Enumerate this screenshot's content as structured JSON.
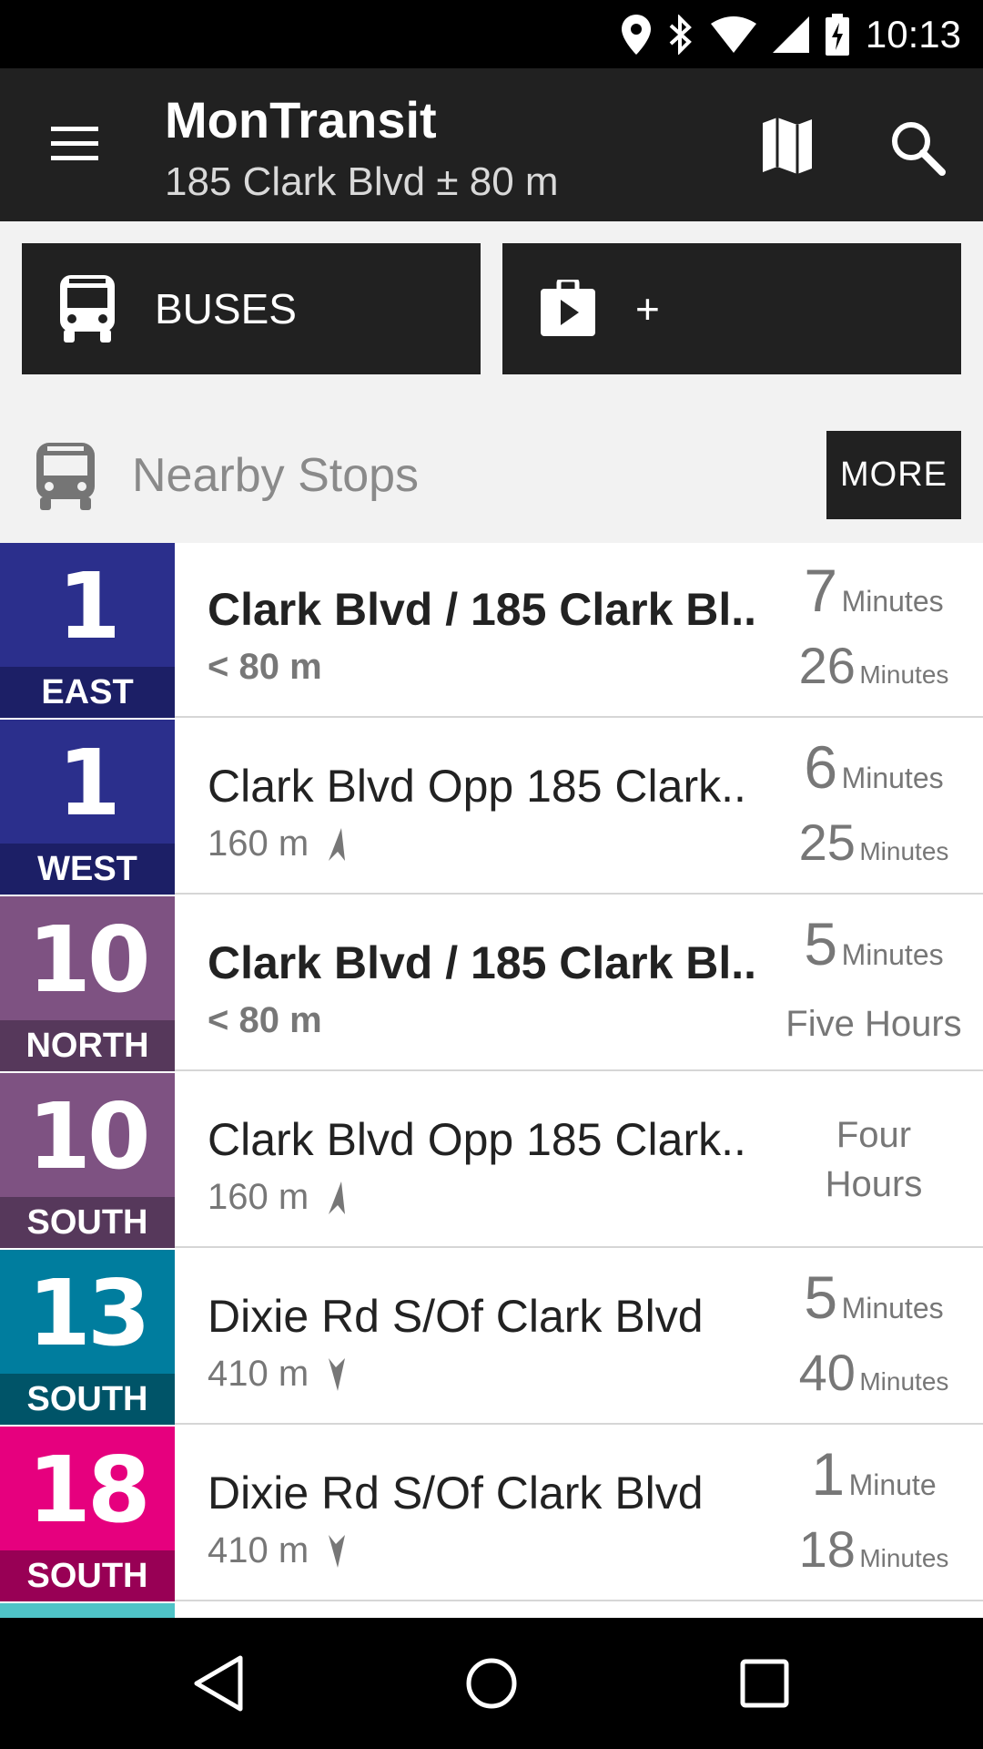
{
  "status_bar": {
    "time": "10:13",
    "icons": [
      "location-pin-icon",
      "bluetooth-icon",
      "wifi-icon",
      "cell-signal-icon",
      "battery-charging-icon"
    ]
  },
  "app_bar": {
    "title": "MonTransit",
    "subtitle": "185 Clark Blvd ± 80 m",
    "icons": [
      "menu-icon",
      "map-icon",
      "search-icon"
    ]
  },
  "modules": {
    "buses_label": "BUSES",
    "add_label": "+"
  },
  "nearby": {
    "title": "Nearby Stops",
    "more_label": "MORE"
  },
  "stops": [
    {
      "route": "1",
      "direction": "EAST",
      "color": "#2b2f8c",
      "dir_color": "#1c1f66",
      "name": "Clark Blvd / 185 Clark Bl..",
      "bold": true,
      "distance": "< 80 m",
      "compass": "",
      "t1": "7",
      "u1": "Minutes",
      "t2": "26",
      "u2": "Minutes"
    },
    {
      "route": "1",
      "direction": "WEST",
      "color": "#2b2f8c",
      "dir_color": "#1c1f66",
      "name": "Clark Blvd Opp 185 Clark..",
      "bold": false,
      "distance": "160 m",
      "compass": "north",
      "t1": "6",
      "u1": "Minutes",
      "t2": "25",
      "u2": "Minutes"
    },
    {
      "route": "10",
      "direction": "NORTH",
      "color": "#7e5282",
      "dir_color": "#56385b",
      "name": "Clark Blvd / 185 Clark Bl..",
      "bold": true,
      "distance": "< 80 m",
      "compass": "",
      "t1": "5",
      "u1": "Minutes",
      "t2": "",
      "u2": "Five Hours"
    },
    {
      "route": "10",
      "direction": "SOUTH",
      "color": "#7e5282",
      "dir_color": "#56385b",
      "name": "Clark Blvd Opp 185 Clark..",
      "bold": false,
      "distance": "160 m",
      "compass": "north",
      "t1": "",
      "u1": "Four",
      "t2": "",
      "u2": "Hours"
    },
    {
      "route": "13",
      "direction": "SOUTH",
      "color": "#007d9e",
      "dir_color": "#005468",
      "name": "Dixie Rd S/Of Clark Blvd",
      "bold": false,
      "distance": "410 m",
      "compass": "south",
      "t1": "5",
      "u1": "Minutes",
      "t2": "40",
      "u2": "Minutes"
    },
    {
      "route": "18",
      "direction": "SOUTH",
      "color": "#e6007e",
      "dir_color": "#980055",
      "name": "Dixie Rd S/Of Clark Blvd",
      "bold": false,
      "distance": "410 m",
      "compass": "south",
      "t1": "1",
      "u1": "Minute",
      "t2": "18",
      "u2": "Minutes"
    }
  ],
  "next_badge_color": "#4fc3c7",
  "nav_bar": {
    "icons": [
      "back-icon",
      "home-icon",
      "recents-icon"
    ]
  }
}
